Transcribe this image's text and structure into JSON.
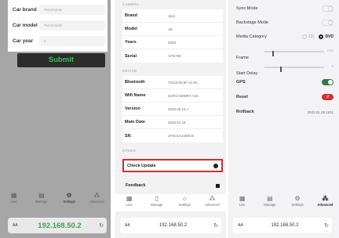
{
  "panel1": {
    "fields": [
      {
        "label": "Car brand",
        "placeholder": "Placeholder"
      },
      {
        "label": "Car model",
        "placeholder": "Placeholder"
      },
      {
        "label": "Car year",
        "placeholder": "0"
      }
    ],
    "submit_label": "Submit",
    "tabs": [
      {
        "icon": "▦",
        "label": "Live"
      },
      {
        "icon": "▤",
        "label": "Manage"
      },
      {
        "icon": "⚙",
        "label": "Settings"
      },
      {
        "icon": "⁂",
        "label": "Advanced"
      }
    ],
    "url": {
      "aa": "AA",
      "address": "192.168.50.2",
      "reload": "↻"
    }
  },
  "panel2": {
    "section_camera": "CAMERA",
    "camera_rows": [
      {
        "key": "Brand",
        "value": "Apxl"
      },
      {
        "key": "Model",
        "value": "A9"
      },
      {
        "key": "Years",
        "value": "2023"
      },
      {
        "key": "Serial",
        "value": "CFN700"
      }
    ],
    "section_device": "DEVICE",
    "device_rows": [
      {
        "key": "Bluetooth",
        "value": "70:D3:92:6F:A4:0C"
      },
      {
        "key": "Wifi Name",
        "value": "SCRCAMWIFI-A4C"
      },
      {
        "key": "Version",
        "value": "2023.05.16.1"
      },
      {
        "key": "Main Date",
        "value": "2023.01.18"
      },
      {
        "key": "SN",
        "value": "1F9C4A21B0C8"
      }
    ],
    "section_other": "OTHER",
    "check_update_label": "Check Update",
    "feedback_label": "Feedback",
    "tabs": [
      {
        "icon": "▦",
        "label": "Live"
      },
      {
        "icon": "▯",
        "label": "Manage"
      },
      {
        "icon": "⌂",
        "label": "Settings"
      },
      {
        "icon": "⁂",
        "label": "Advanced"
      }
    ],
    "url": {
      "aa": "AA",
      "address": "192.168.50.2",
      "reload": "↻"
    }
  },
  "panel3": {
    "sync_mode": "Sync Mode",
    "backstage_mode": "Backstage Mode",
    "media_category": "Media Category",
    "media_options": [
      "CD",
      "DVD"
    ],
    "frame_label": "Frame",
    "frame_unit": "FPS",
    "start_delay_label": "Start Delay",
    "start_delay_unit": "S",
    "gps_label": "GPS",
    "reset_label": "Reset",
    "rollback_label": "Rollback",
    "rollback_value": "2023.01.28.1811",
    "tabs": [
      {
        "icon": "▦",
        "label": "Live"
      },
      {
        "icon": "▤",
        "label": "Manage"
      },
      {
        "icon": "⚙",
        "label": "Settings"
      },
      {
        "icon": "⁂",
        "label": "Advanced"
      }
    ],
    "url": {
      "aa": "AA",
      "address": "192.168.50.2",
      "reload": "↻"
    }
  }
}
